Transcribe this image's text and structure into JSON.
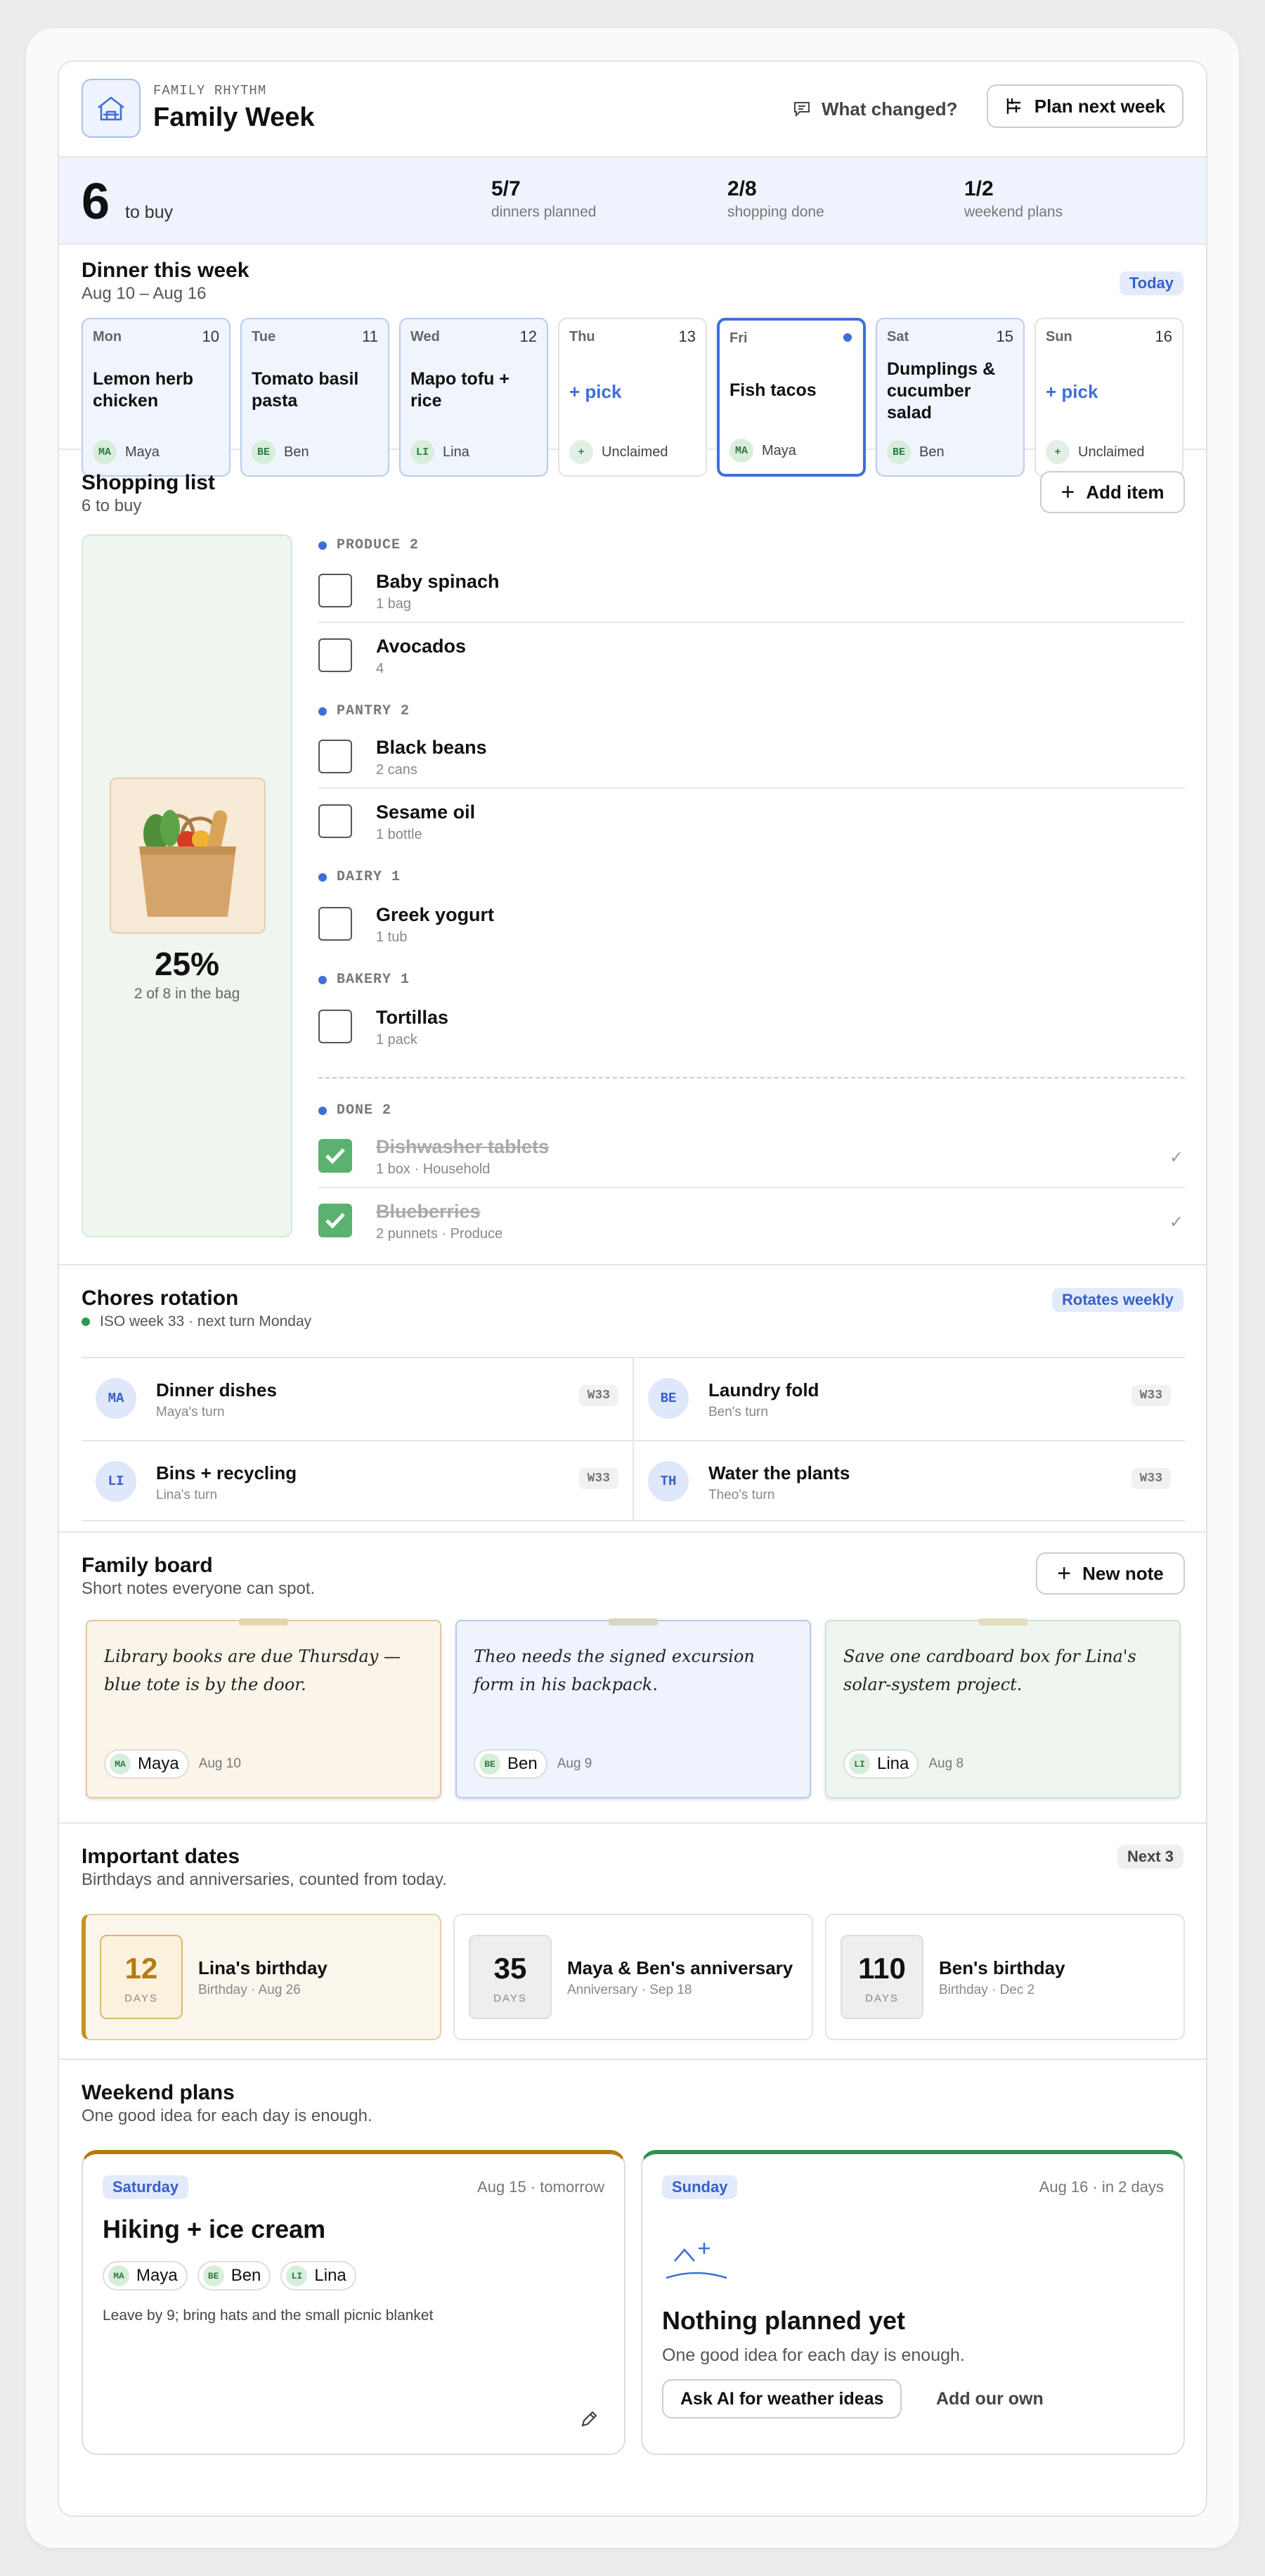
{
  "header": {
    "eyebrow": "FAMILY RHYTHM",
    "title": "Family Week",
    "what_changed": "What changed?",
    "plan_button": "Plan next week",
    "logo_icon": "home-icon"
  },
  "stats": {
    "to_buy_count": "6",
    "to_buy_label": "to buy",
    "items": [
      {
        "value": "5/7",
        "label": "dinners planned"
      },
      {
        "value": "2/8",
        "label": "shopping done"
      },
      {
        "value": "1/2",
        "label": "weekend plans"
      }
    ]
  },
  "dinner": {
    "title": "Dinner this week",
    "range": "Aug 10 – Aug 16",
    "today_pill": "Today",
    "days": [
      {
        "name": "Mon",
        "date": "10",
        "meal": "Lemon herb chicken",
        "initials": "MA",
        "who": "Maya"
      },
      {
        "name": "Tue",
        "date": "11",
        "meal": "Tomato basil pasta",
        "initials": "BE",
        "who": "Ben"
      },
      {
        "name": "Wed",
        "date": "12",
        "meal": "Mapo tofu + rice",
        "initials": "LI",
        "who": "Lina"
      },
      {
        "name": "Thu",
        "date": "13",
        "meal": "+ pick",
        "initials": "+",
        "who": "Unclaimed"
      },
      {
        "name": "Fri",
        "date": "",
        "meal": "Fish tacos",
        "initials": "MA",
        "who": "Maya"
      },
      {
        "name": "Sat",
        "date": "15",
        "meal": "Dumplings & cucumber salad",
        "initials": "BE",
        "who": "Ben"
      },
      {
        "name": "Sun",
        "date": "16",
        "meal": "+ pick",
        "initials": "+",
        "who": "Unclaimed"
      }
    ]
  },
  "shopping": {
    "title": "Shopping list",
    "subtitle": "6 to buy",
    "add_button": "Add item",
    "percent": "25%",
    "percent_value": 25,
    "percent_sub": "2 of 8 in the bag",
    "groups": [
      {
        "label": "PRODUCE 2",
        "items": [
          {
            "name": "Baby spinach",
            "qty": "1 bag"
          },
          {
            "name": "Avocados",
            "qty": "4"
          }
        ]
      },
      {
        "label": "PANTRY 2",
        "items": [
          {
            "name": "Black beans",
            "qty": "2 cans"
          },
          {
            "name": "Sesame oil",
            "qty": "1 bottle"
          }
        ]
      },
      {
        "label": "DAIRY 1",
        "items": [
          {
            "name": "Greek yogurt",
            "qty": "1 tub"
          }
        ]
      },
      {
        "label": "BAKERY 1",
        "items": [
          {
            "name": "Tortillas",
            "qty": "1 pack"
          }
        ]
      }
    ],
    "done_label": "DONE 2",
    "done": [
      {
        "name": "Dishwasher tablets",
        "qty": "1 box · Household"
      },
      {
        "name": "Blueberries",
        "qty": "2 punnets · Produce"
      }
    ]
  },
  "chores": {
    "title": "Chores rotation",
    "pill": "Rotates weekly",
    "status": "ISO week 33 · next turn Monday",
    "items": [
      {
        "initials": "MA",
        "name": "Dinner dishes",
        "turn": "Maya's turn",
        "week": "W33"
      },
      {
        "initials": "BE",
        "name": "Laundry fold",
        "turn": "Ben's turn",
        "week": "W33"
      },
      {
        "initials": "LI",
        "name": "Bins + recycling",
        "turn": "Lina's turn",
        "week": "W33"
      },
      {
        "initials": "TH",
        "name": "Water the plants",
        "turn": "Theo's turn",
        "week": "W33"
      }
    ]
  },
  "board": {
    "title": "Family board",
    "subtitle": "Short notes everyone can spot.",
    "new_button": "New note",
    "notes": [
      {
        "text": "Library books are due Thursday — blue tote is by the door.",
        "initials": "MA",
        "who": "Maya",
        "date": "Aug 10",
        "bg": "#fbf4e8",
        "border": "#e5c99c",
        "tape": "#e8d5b0"
      },
      {
        "text": "Theo needs the signed excursion form in his backpack.",
        "initials": "BE",
        "who": "Ben",
        "date": "Aug 9",
        "bg": "#eef3fd",
        "border": "#b6c9ee",
        "tape": "#d9d6c6"
      },
      {
        "text": "Save one cardboard box for Lina's solar-system project.",
        "initials": "LI",
        "who": "Lina",
        "date": "Aug 8",
        "bg": "#eff6ef",
        "border": "#cfe2d2",
        "tape": "#e2dcc0"
      }
    ]
  },
  "dates": {
    "title": "Important dates",
    "subtitle": "Birthdays and anniversaries, counted from today.",
    "pill": "Next 3",
    "unit": "DAYS",
    "items": [
      {
        "days": "12",
        "label": "Lina's birthday",
        "sub": "Birthday · Aug 26"
      },
      {
        "days": "35",
        "label": "Maya & Ben's anniversary",
        "sub": "Anniversary · Sep 18"
      },
      {
        "days": "110",
        "label": "Ben's birthday",
        "sub": "Birthday · Dec 2"
      }
    ]
  },
  "weekend": {
    "title": "Weekend plans",
    "subtitle": "One good idea for each day is enough.",
    "saturday": {
      "day": "Saturday",
      "date": "Aug 15 · tomorrow",
      "plan": "Hiking + ice cream",
      "people": [
        {
          "initials": "MA",
          "who": "Maya"
        },
        {
          "initials": "BE",
          "who": "Ben"
        },
        {
          "initials": "LI",
          "who": "Lina"
        }
      ],
      "note": "Leave by 9; bring hats and the small picnic blanket",
      "accent": "#b27c12"
    },
    "sunday": {
      "day": "Sunday",
      "date": "Aug 16 · in 2 days",
      "empty_title": "Nothing planned yet",
      "empty_sub": "One good idea for each day is enough.",
      "ai_button": "Ask AI for weather ideas",
      "own_button": "Add our own",
      "accent": "#2f8f52"
    }
  }
}
